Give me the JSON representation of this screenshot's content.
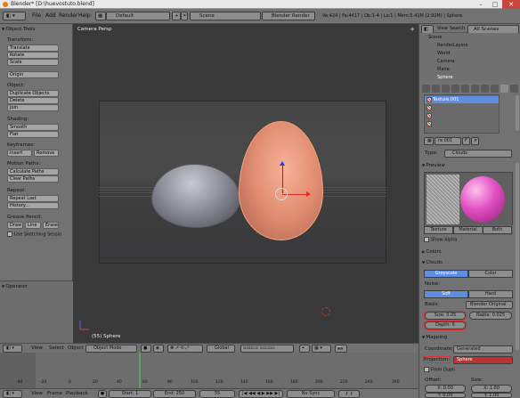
{
  "title_bar": {
    "title": "Blender* [D:\\huevostuto.blend]",
    "minimize": "–",
    "maximize": "□",
    "close": "✕"
  },
  "info_header": {
    "menus": [
      "File",
      "Add",
      "Render",
      "Help"
    ],
    "screen_layout": "Default",
    "scene": "Scene",
    "render_engine": "Blender Render",
    "stats": "Ve:424 | Fa:4417 | Ob:1-4 | La:1 | Mem:5.41M (2.92M) | Sphere"
  },
  "tool_shelf": {
    "title": "Object Tools",
    "sections": {
      "transform": {
        "label": "Transform:",
        "buttons": [
          "Translate",
          "Rotate",
          "Scale"
        ]
      },
      "origin": "Origin",
      "object": {
        "label": "Object:",
        "buttons": [
          "Duplicate Objects",
          "Delete",
          "Join"
        ]
      },
      "shading": {
        "label": "Shading:",
        "buttons": [
          "Smooth",
          "Flat"
        ]
      },
      "keyframes": {
        "label": "Keyframes:",
        "insert": "Insert",
        "remove": "Remove"
      },
      "motion_paths": {
        "label": "Motion Paths:",
        "buttons": [
          "Calculate Paths",
          "Clear Paths"
        ]
      },
      "repeat": {
        "label": "Repeat:",
        "buttons": [
          "Repeat Last",
          "History..."
        ]
      },
      "grease_pencil": {
        "label": "Grease Pencil:",
        "draw": "Draw",
        "line": "Line",
        "erase": "Erase",
        "sketching": "Use Sketching Sessio"
      }
    },
    "operator": "Operator"
  },
  "viewport": {
    "label": "Camera Persp",
    "object_label": "(55) Sphere",
    "plus": "+"
  },
  "viewport_header": {
    "menus": [
      "View",
      "Select",
      "Object"
    ],
    "mode": "Object Mode",
    "pivot": "Global"
  },
  "timeline": {
    "ruler": [
      "-40",
      "-20",
      "0",
      "20",
      "40",
      "60",
      "80",
      "100",
      "120",
      "140",
      "160",
      "180",
      "200",
      "220",
      "240",
      "260"
    ],
    "menus": [
      "View",
      "Frame",
      "Playback"
    ],
    "start": "Start: 1",
    "end": "End: 250",
    "current": "55",
    "sync": "No Sync"
  },
  "outliner": {
    "menus": [
      "View",
      "Search"
    ],
    "filter": "All Scenes",
    "items": [
      "Scene",
      "RenderLayers",
      "World",
      "Camera",
      "Plane",
      "Sphere"
    ]
  },
  "properties": {
    "slots": [
      "Texture.001"
    ],
    "texture_name": "re.001",
    "f_label": "F",
    "type_label": "Type:",
    "type_value": "Clouds",
    "preview_header": "Preview",
    "preview_tabs": [
      "Texture",
      "Material",
      "Both"
    ],
    "show_alpha": "Show Alpha",
    "colors_header": "Colors",
    "clouds_header": "Clouds",
    "color_mode": [
      "Greyscale",
      "Color"
    ],
    "noise_label": "Noise:",
    "noise_mode": [
      "Soft",
      "Hard"
    ],
    "basis_label": "Basis:",
    "basis_value": "Blender Original",
    "size": "Size: 0.05",
    "nabla": "Nabla: 0.025",
    "depth": "Depth: 6",
    "mapping_header": "Mapping",
    "coordinates_label": "Coordinate:",
    "coordinates_value": "Generated",
    "projection_label": "Projection:",
    "projection_value": "Sphere",
    "from_dupli": "From Dupli",
    "offset_label": "Offset:",
    "size_label": "Size:",
    "offset_x": "X: 0.00",
    "offset_y": "Y: 0.00",
    "size_x": "X: 1.00",
    "size_y": "Y: 1.00"
  }
}
